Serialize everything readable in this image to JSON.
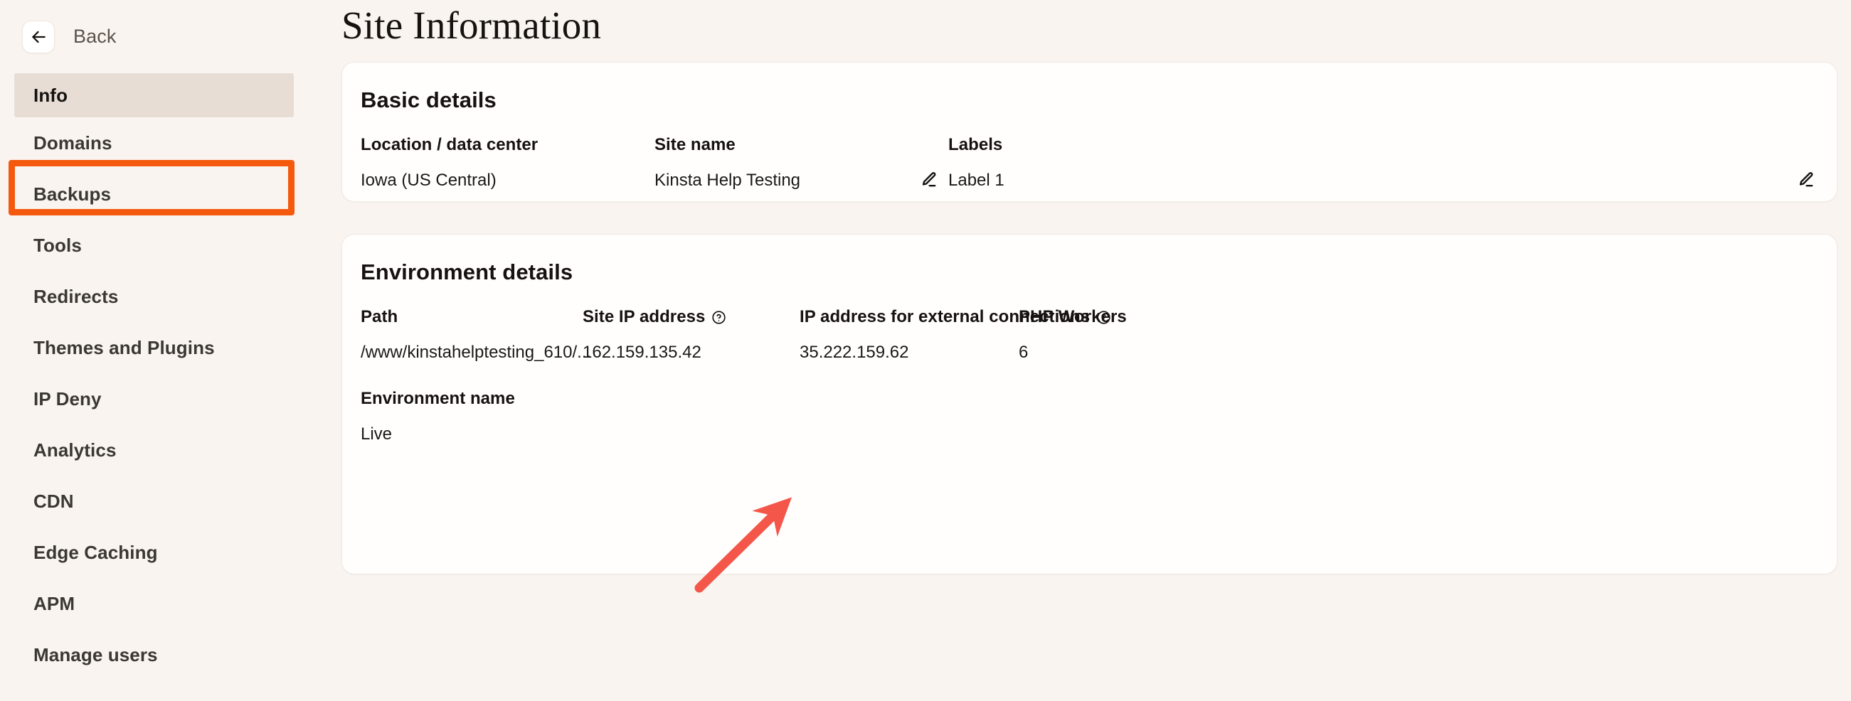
{
  "nav": {
    "back_label": "Back",
    "back_icon": "arrow-left-icon",
    "items": [
      {
        "label": "Info",
        "active": true
      },
      {
        "label": "Domains",
        "active": false
      },
      {
        "label": "Backups",
        "active": false
      },
      {
        "label": "Tools",
        "active": false
      },
      {
        "label": "Redirects",
        "active": false
      },
      {
        "label": "Themes and Plugins",
        "active": false
      },
      {
        "label": "IP Deny",
        "active": false
      },
      {
        "label": "Analytics",
        "active": false
      },
      {
        "label": "CDN",
        "active": false
      },
      {
        "label": "Edge Caching",
        "active": false
      },
      {
        "label": "APM",
        "active": false
      },
      {
        "label": "Manage users",
        "active": false
      }
    ]
  },
  "page": {
    "title": "Site Information"
  },
  "basic_details": {
    "heading": "Basic details",
    "location_label": "Location / data center",
    "location_value": "Iowa (US Central)",
    "site_name_label": "Site name",
    "site_name_value": "Kinsta Help Testing",
    "labels_label": "Labels",
    "labels_value": "Label 1",
    "edit_icon": "pencil-icon"
  },
  "environment_details": {
    "heading": "Environment details",
    "path_label": "Path",
    "path_value": "/www/kinstahelptesting_610/...",
    "site_ip_label": "Site IP address",
    "site_ip_value": "162.159.135.42",
    "external_ip_label": "IP address for external connections",
    "external_ip_value": "35.222.159.62",
    "php_workers_label": "PHP Workers",
    "php_workers_value": "6",
    "env_name_label": "Environment name",
    "env_name_value": "Live",
    "help_icon": "question-circle-icon"
  },
  "annotations": {
    "highlight_color": "#f4590e",
    "arrow_color": "#f4574a",
    "active_item_bg": "#e7ddd5",
    "page_bg": "#f9f4f0",
    "card_bg": "#fffefd"
  }
}
